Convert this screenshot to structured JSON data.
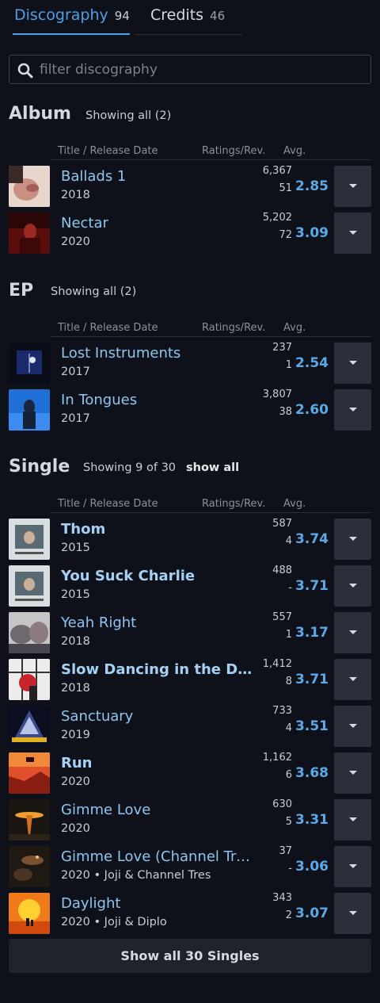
{
  "tabs": [
    {
      "label": "Discography",
      "count": "94"
    },
    {
      "label": "Credits",
      "count": "46"
    }
  ],
  "search": {
    "placeholder": "filter discography",
    "value": ""
  },
  "columns": {
    "title": "Title / Release Date",
    "ratings": "Ratings/Rev.",
    "avg": "Avg."
  },
  "sections": {
    "album": {
      "title": "Album",
      "showing": "Showing all (2)",
      "rows": [
        {
          "title": "Ballads 1",
          "sub": "2018",
          "ratings": "6,367",
          "reviews": "51",
          "avg": "2.85"
        },
        {
          "title": "Nectar",
          "sub": "2020",
          "ratings": "5,202",
          "reviews": "72",
          "avg": "3.09"
        }
      ]
    },
    "ep": {
      "title": "EP",
      "showing": "Showing all (2)",
      "rows": [
        {
          "title": "Lost Instruments",
          "sub": "2017",
          "ratings": "237",
          "reviews": "1",
          "avg": "2.54"
        },
        {
          "title": "In Tongues",
          "sub": "2017",
          "ratings": "3,807",
          "reviews": "38",
          "avg": "2.60"
        }
      ]
    },
    "single": {
      "title": "Single",
      "showing": "Showing 9 of 30",
      "show_all": "show all",
      "rows": [
        {
          "title": "Thom",
          "sub": "2015",
          "ratings": "587",
          "reviews": "4",
          "avg": "3.74"
        },
        {
          "title": "You Suck Charlie",
          "sub": "2015",
          "ratings": "488",
          "reviews": "-",
          "avg": "3.71"
        },
        {
          "title": "Yeah Right",
          "sub": "2018",
          "ratings": "557",
          "reviews": "1",
          "avg": "3.17"
        },
        {
          "title": "Slow Dancing in the Dark",
          "sub": "2018",
          "ratings": "1,412",
          "reviews": "8",
          "avg": "3.71"
        },
        {
          "title": "Sanctuary",
          "sub": "2019",
          "ratings": "733",
          "reviews": "4",
          "avg": "3.51"
        },
        {
          "title": "Run",
          "sub": "2020",
          "ratings": "1,162",
          "reviews": "6",
          "avg": "3.68"
        },
        {
          "title": "Gimme Love",
          "sub": "2020",
          "ratings": "630",
          "reviews": "5",
          "avg": "3.31"
        },
        {
          "title": "Gimme Love (Channel Tres Remix)",
          "sub": "2020 • Joji & Channel Tres",
          "ratings": "37",
          "reviews": "-",
          "avg": "3.06"
        },
        {
          "title": "Daylight",
          "sub": "2020 • Joji & Diplo",
          "ratings": "343",
          "reviews": "2",
          "avg": "3.07"
        }
      ],
      "show_all_button": "Show all 30 Singles"
    }
  },
  "colors": {
    "accent": "#4f9fe8",
    "avg": "#5aaae8",
    "background": "#0e1119",
    "button": "#2a2f3a"
  }
}
